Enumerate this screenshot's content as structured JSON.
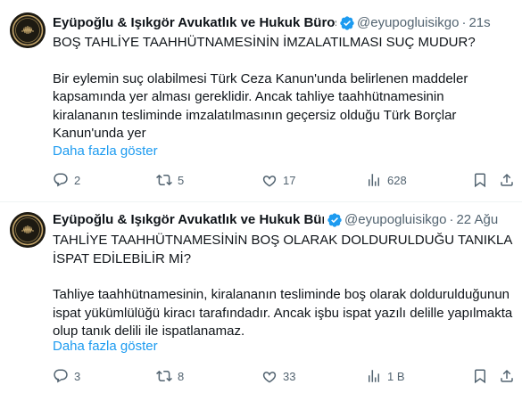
{
  "tweets": [
    {
      "author": "Eyüpoğlu & Işıkgör Avukatlık ve Hukuk Bürosu",
      "handle": "@eyupogluisikgo",
      "time": "21s",
      "headline": "BOŞ TAHLİYE TAAHHÜTNAMESİNİN İMZALATILMASI SUÇ MUDUR?",
      "paragraph": "Bir eylemin suç olabilmesi Türk Ceza Kanun'unda belirlenen maddeler kapsamında yer alması gereklidir. Ancak tahliye taahhütnamesinin kiralananın tesliminde imzalatılmasının geçersiz olduğu Türk Borçlar Kanun'unda yer",
      "show_more": "Daha fazla göster",
      "replies": "2",
      "reposts": "5",
      "likes": "17",
      "views": "628"
    },
    {
      "author": "Eyüpoğlu & Işıkgör Avukatlık ve Hukuk Bürosu",
      "handle": "@eyupogluisikgo",
      "time": "22 Ağu",
      "headline": "TAHLİYE TAAHHÜTNAMESİNİN BOŞ OLARAK DOLDURULDUĞU TANIKLA İSPAT EDİLEBİLİR Mİ?",
      "paragraph": "Tahliye taahhütnamesinin, kiralananın tesliminde boş olarak doldurulduğunun ispat yükümlülüğü kiracı tarafındadır. Ancak işbu ispat yazılı delille yapılmakta olup tanık delili ile ispatlanamaz.",
      "show_more": "Daha fazla göster",
      "replies": "3",
      "reposts": "8",
      "likes": "33",
      "views": "1 B"
    }
  ],
  "separator": "·",
  "icons": [
    "verified-badge-icon",
    "reply-icon",
    "repost-icon",
    "like-icon",
    "views-icon",
    "bookmark-icon",
    "share-icon"
  ],
  "colors": {
    "accent": "#1d9bf0",
    "muted": "#536471",
    "text": "#0f1419",
    "avatar_gold": "#c2a46a"
  }
}
